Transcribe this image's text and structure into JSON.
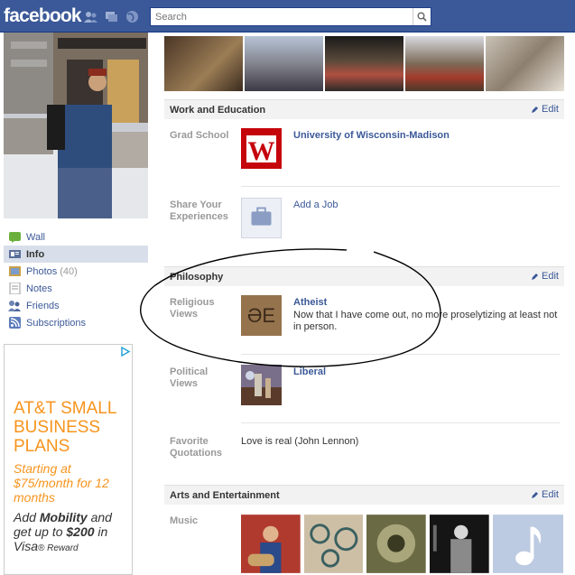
{
  "header": {
    "logo": "facebook",
    "search_placeholder": "Search"
  },
  "sidebar": {
    "items": [
      {
        "label": "Wall",
        "icon": "wall-icon",
        "count": ""
      },
      {
        "label": "Info",
        "icon": "info-icon",
        "count": ""
      },
      {
        "label": "Photos",
        "icon": "photos-icon",
        "count": "(40)"
      },
      {
        "label": "Notes",
        "icon": "notes-icon",
        "count": ""
      },
      {
        "label": "Friends",
        "icon": "friends-icon",
        "count": ""
      },
      {
        "label": "Subscriptions",
        "icon": "subscriptions-icon",
        "count": ""
      }
    ]
  },
  "ad": {
    "headline": "AT&T SMALL BUSINESS PLANS",
    "price": "Starting at $75/month for 12 months",
    "offer_prefix": "Add ",
    "offer_bold": "Mobility",
    "offer_middle": " and get up to ",
    "offer_amount": "$200",
    "offer_suffix": " in Visa",
    "offer_reward": "® Reward"
  },
  "sections": {
    "work": {
      "title": "Work and Education",
      "edit": "Edit",
      "grad_label": "Grad School",
      "grad_value": "University of Wisconsin-Madison",
      "share_label": "Share Your Experiences",
      "share_value": "Add a Job"
    },
    "philosophy": {
      "title": "Philosophy",
      "edit": "Edit",
      "religious_label": "Religious Views",
      "religious_value": "Atheist",
      "religious_desc": "Now that I have come out, no more proselytizing at least not in person.",
      "political_label": "Political Views",
      "political_value": "Liberal",
      "quotes_label": "Favorite Quotations",
      "quotes_value": "Love is real (John Lennon)"
    },
    "arts": {
      "title": "Arts and Entertainment",
      "edit": "Edit",
      "music_label": "Music"
    }
  },
  "colors": {
    "brand": "#3b5998",
    "ad_accent": "#f7941d"
  }
}
